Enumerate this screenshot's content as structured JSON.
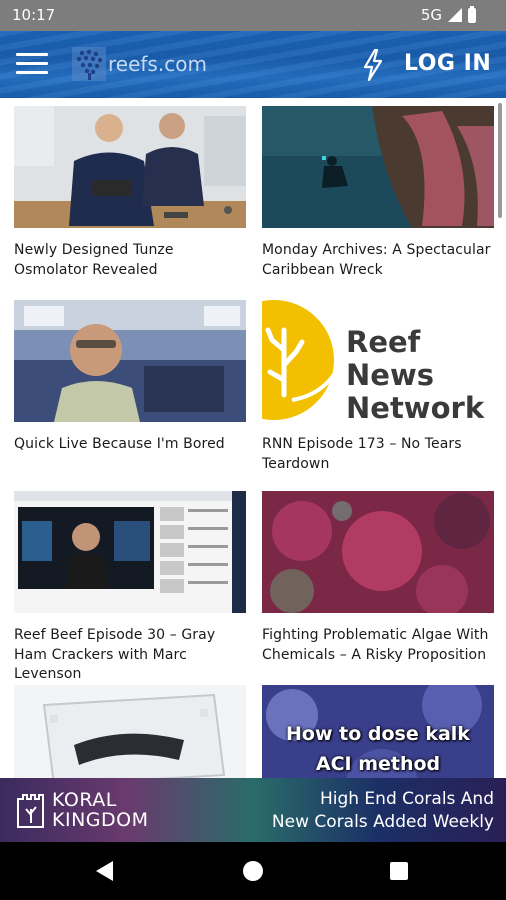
{
  "status_bar": {
    "time": "10:17",
    "network": "5G"
  },
  "app_bar": {
    "logo_text": "reefs.com",
    "login_label": "LOG IN"
  },
  "articles": [
    {
      "title": "Newly Designed Tunze Osmolator Revealed"
    },
    {
      "title": "Monday Archives: A Spectacular Caribbean Wreck"
    },
    {
      "title": "Quick Live Because I'm Bored"
    },
    {
      "title": "RNN Episode 173 – No Tears Teardown",
      "thumb_text": "Reef News Network"
    },
    {
      "title": "Reef Beef Episode 30 – Gray Ham Crackers with Marc Levenson"
    },
    {
      "title": "Fighting Problematic Algae With Chemicals – A Risky Proposition"
    },
    {
      "title": ""
    },
    {
      "title": "",
      "thumb_text_line1": "How to dose kalk",
      "thumb_text_line2": "ACI method"
    }
  ],
  "ad": {
    "brand_line1": "KORAL",
    "brand_line2": "KINGDOM",
    "copy_line1": "High End Corals And",
    "copy_line2": "New Corals Added Weekly"
  },
  "colors": {
    "app_bar": "#1c64b8",
    "status_bar": "#7d7d7d",
    "rnn_yellow": "#f2c000"
  }
}
